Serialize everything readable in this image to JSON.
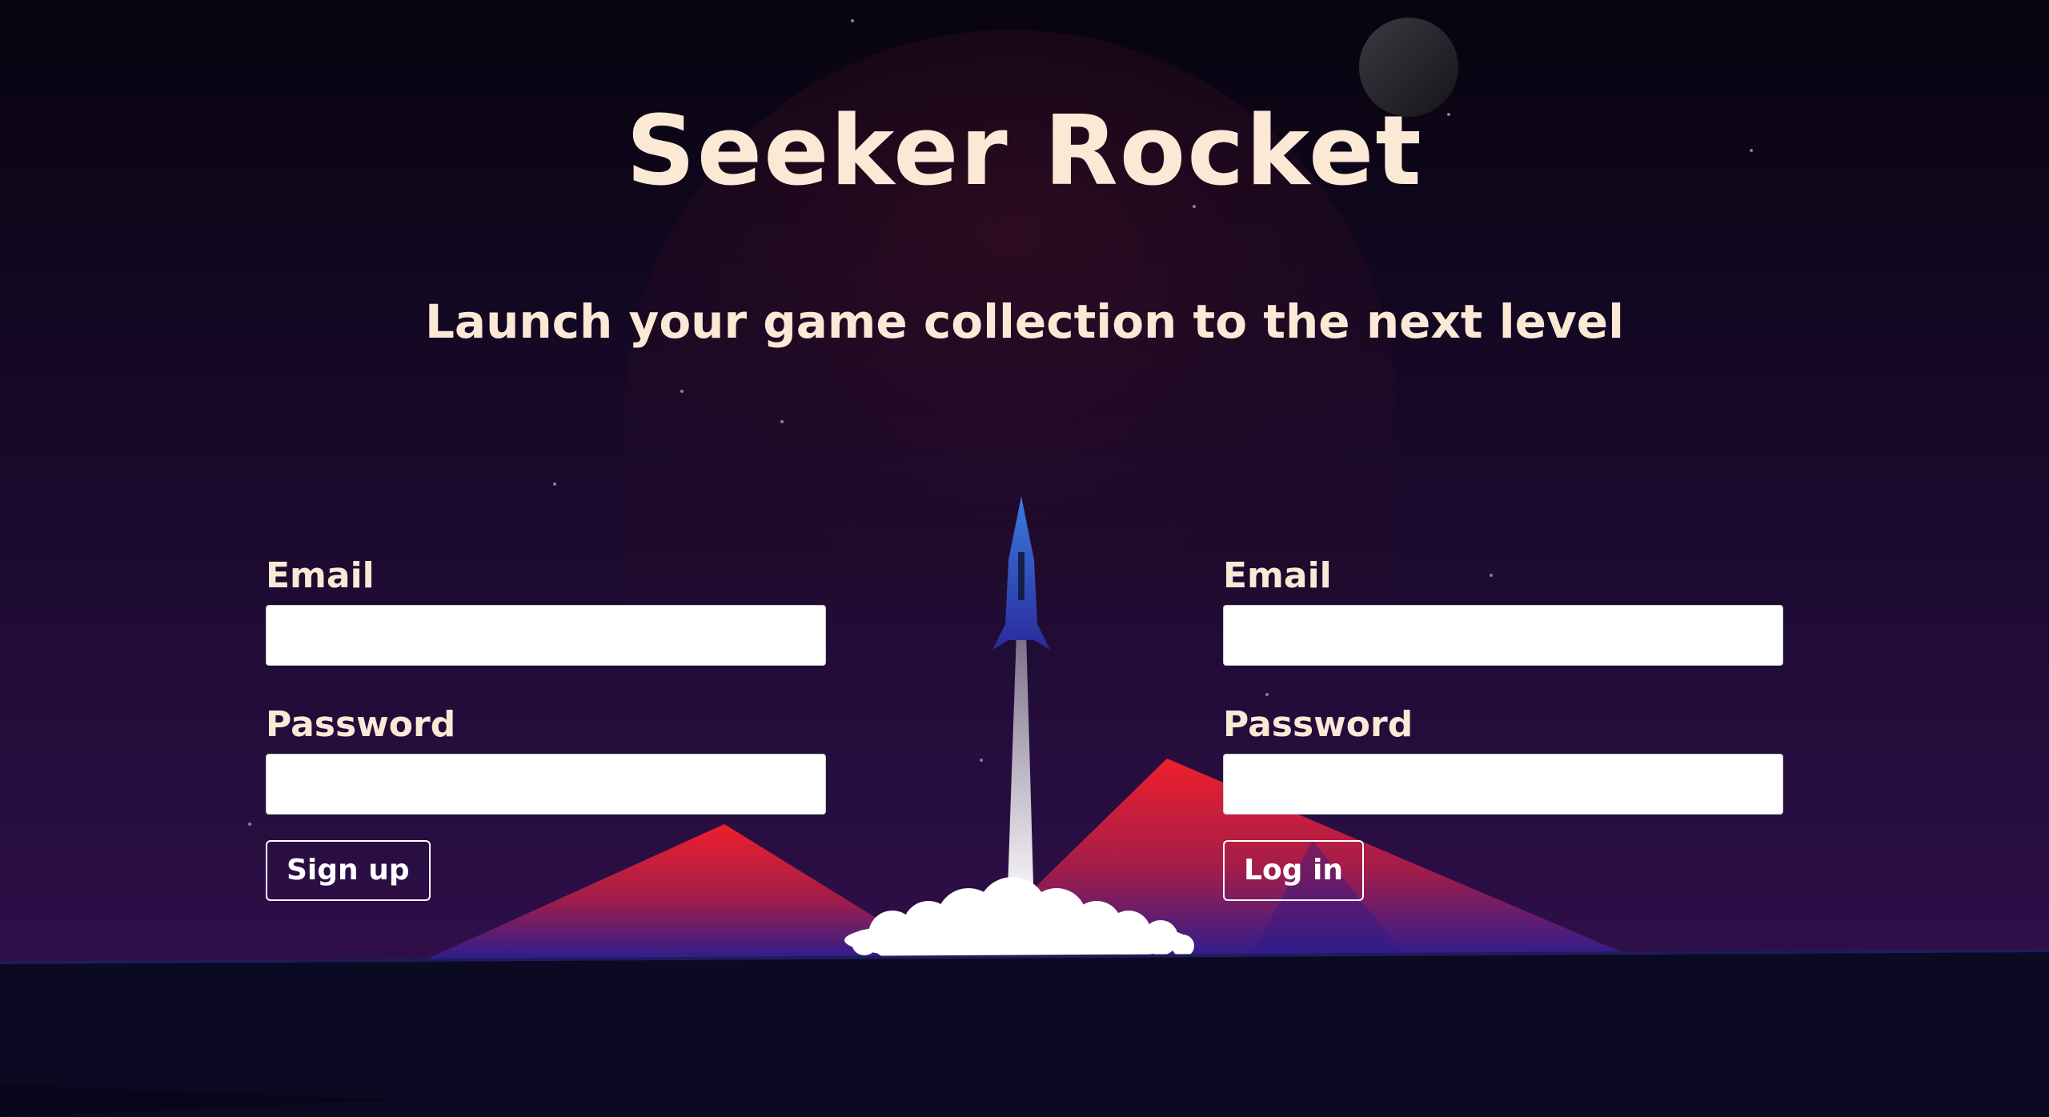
{
  "header": {
    "title": "Seeker Rocket",
    "tagline": "Launch your game collection to the next level"
  },
  "signup_form": {
    "email_label": "Email",
    "email_value": "",
    "password_label": "Password",
    "password_value": "",
    "submit_label": "Sign up"
  },
  "login_form": {
    "email_label": "Email",
    "email_value": "",
    "password_label": "Password",
    "password_value": "",
    "submit_label": "Log in"
  },
  "colors": {
    "text_cream": "#fbe9d6",
    "sky_top": "#0a0618",
    "sky_bottom": "#2b0f46",
    "mountain_red": "#e8202f",
    "mountain_blue": "#2a1a8a",
    "ground": "#0b0a22",
    "rocket_blue": "#2f6fd6"
  }
}
